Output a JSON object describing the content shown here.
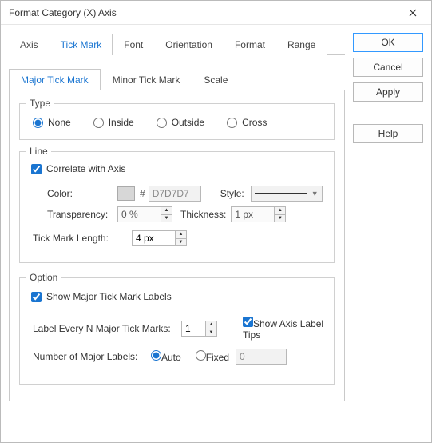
{
  "window": {
    "title": "Format Category (X) Axis"
  },
  "tabs": {
    "axis": "Axis",
    "tickmark": "Tick Mark",
    "font": "Font",
    "orientation": "Orientation",
    "format": "Format",
    "range": "Range"
  },
  "subtabs": {
    "major": "Major Tick Mark",
    "minor": "Minor Tick Mark",
    "scale": "Scale"
  },
  "type": {
    "legend": "Type",
    "none": "None",
    "inside": "Inside",
    "outside": "Outside",
    "cross": "Cross"
  },
  "line": {
    "legend": "Line",
    "correlate": "Correlate with Axis",
    "color_label": "Color:",
    "hash": "#",
    "color_value": "D7D7D7",
    "style_label": "Style:",
    "transparency_label": "Transparency:",
    "transparency_value": "0 %",
    "thickness_label": "Thickness:",
    "thickness_value": "1 px",
    "ticklen_label": "Tick Mark Length:",
    "ticklen_value": "4 px"
  },
  "option": {
    "legend": "Option",
    "show_major": "Show Major Tick Mark Labels",
    "every_n_label": "Label Every N Major Tick Marks:",
    "every_n_value": "1",
    "show_tips": "Show Axis Label Tips",
    "num_labels_label": "Number of Major Labels:",
    "auto": "Auto",
    "fixed": "Fixed",
    "fixed_value": "0"
  },
  "buttons": {
    "ok": "OK",
    "cancel": "Cancel",
    "apply": "Apply",
    "help": "Help"
  }
}
